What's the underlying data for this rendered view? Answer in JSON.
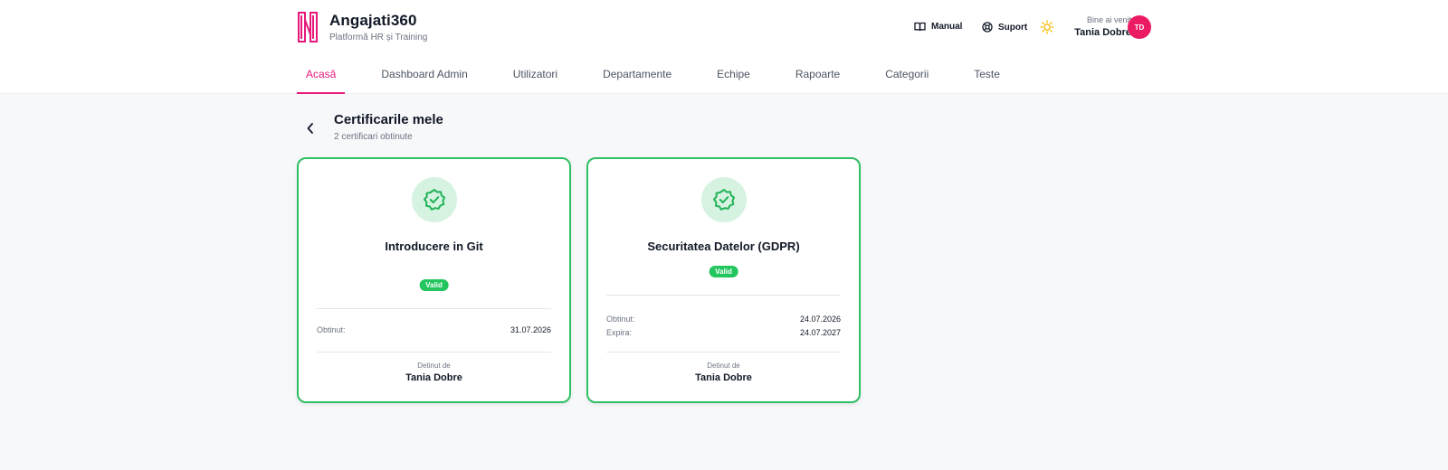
{
  "brand": {
    "name": "Angajati360",
    "subtitle": "Platformă HR și Training"
  },
  "top_actions": {
    "manual_label": "Manual",
    "suport_label": "Suport",
    "theme_icon": "sun-icon"
  },
  "user": {
    "welcome": "Bine ai venit",
    "name": "Tania Dobre",
    "initials": "TD"
  },
  "nav": {
    "tabs": [
      {
        "label": "Acasă",
        "active": true
      },
      {
        "label": "Dashboard Admin",
        "active": false
      },
      {
        "label": "Utilizatori",
        "active": false
      },
      {
        "label": "Departamente",
        "active": false
      },
      {
        "label": "Echipe",
        "active": false
      },
      {
        "label": "Rapoarte",
        "active": false
      },
      {
        "label": "Categorii",
        "active": false
      },
      {
        "label": "Teste",
        "active": false
      }
    ]
  },
  "page": {
    "title": "Certificarile mele",
    "subtitle": "2 certificari obtinute"
  },
  "certificates": [
    {
      "title": "Introducere in Git",
      "status": "Valid",
      "obtained_label": "Obtinut:",
      "obtained": "31.07.2026",
      "holder_label": "Detinut de",
      "holder": "Tania Dobre"
    },
    {
      "title": "Securitatea Datelor (GDPR)",
      "status": "Valid",
      "obtained_label": "Obtinut:",
      "obtained": "24.07.2026",
      "expires_label": "Expira:",
      "expires": "24.07.2027",
      "holder_label": "Detinut de",
      "holder": "Tania Dobre"
    }
  ],
  "colors": {
    "accent": "#e6197b",
    "avatar": "#ea1a63",
    "success": "#22c55e",
    "card_border": "#2fbf64",
    "badge_bg": "#d5f3e0"
  }
}
